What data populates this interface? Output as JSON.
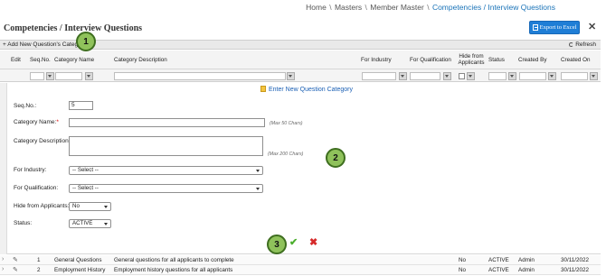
{
  "breadcrumb": {
    "items": [
      "Home",
      "Masters",
      "Member Master"
    ],
    "current": "Competencies / Interview Questions",
    "separator": "\\"
  },
  "page": {
    "title": "Competencies / Interview Questions",
    "export_label": "Export to Excel"
  },
  "toolbar": {
    "add_label": "Add New Question's Category",
    "refresh_label": "Refresh"
  },
  "columns": [
    "Edit",
    "Seq.No.",
    "Category Name",
    "Category Description",
    "For Industry",
    "For Qualification",
    "Hide from Applicants",
    "Status",
    "Created By",
    "Created On"
  ],
  "form": {
    "caption": "Enter New Question Category",
    "seq_label": "Seq.No.:",
    "seq_value": "5",
    "name_label": "Category Name:",
    "name_required": "*",
    "name_hint": "(Max 50 Chars)",
    "desc_label": "Category Description:",
    "desc_hint": "(Max 200 Chars)",
    "industry_label": "For Industry:",
    "industry_value": "-- Select --",
    "qual_label": "For Qualification:",
    "qual_value": "-- Select --",
    "hide_label": "Hide from Applicants:",
    "hide_value": "No",
    "status_label": "Status:",
    "status_value": "ACTIVE"
  },
  "badges": [
    "1",
    "2",
    "3"
  ],
  "rows": [
    {
      "seq": "1",
      "name": "General Questions",
      "desc": "General questions for all applicants to complete",
      "hide": "No",
      "status": "ACTIVE",
      "by": "Admin",
      "on": "30/11/2022"
    },
    {
      "seq": "2",
      "name": "Employment History",
      "desc": "Employment history questions for all applicants",
      "hide": "No",
      "status": "ACTIVE",
      "by": "Admin",
      "on": "30/11/2022"
    }
  ],
  "colors": {
    "accent": "#1f7ed6",
    "link": "#1a73b8",
    "badge": "#8fc25b",
    "save": "#4caf2e",
    "cancel": "#d62b2b"
  }
}
